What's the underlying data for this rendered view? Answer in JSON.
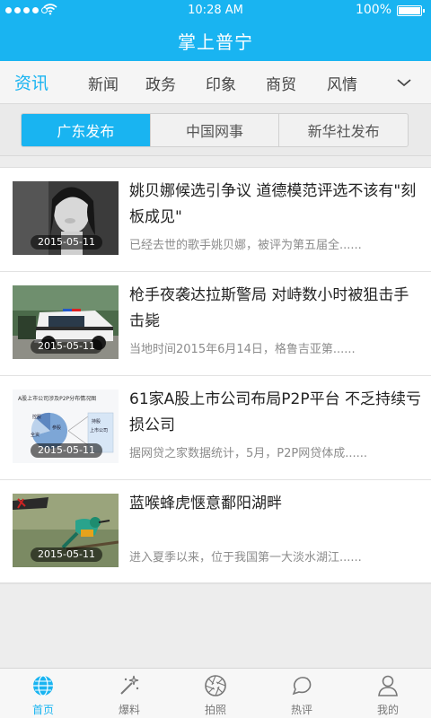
{
  "status": {
    "time": "10:28 AM",
    "battery": "100%"
  },
  "app_title": "掌上普宁",
  "categories": [
    "资讯",
    "新闻",
    "政务",
    "印象",
    "商贸",
    "风情"
  ],
  "segments": [
    "广东发布",
    "中国网事",
    "新华社发布"
  ],
  "news": [
    {
      "title": "姚贝娜候选引争议 道德模范评选不该有\"刻板成见\"",
      "summary": "已经去世的歌手姚贝娜，被评为第五届全......",
      "date": "2015-05-11"
    },
    {
      "title": "枪手夜袭达拉斯警局 对峙数小时被狙击手击毙",
      "summary": "当地时间2015年6月14日，格鲁吉亚第......",
      "date": "2015-05-11"
    },
    {
      "title": "61家A股上市公司布局P2P平台 不乏持续亏损公司",
      "summary": "据网贷之家数据统计，5月，P2P网贷体成......",
      "date": "2015-05-11",
      "thumb_text": "A股上市公司涉及P2P分布情况图",
      "thumb_labels": [
        "控股",
        "参股",
        "全资",
        "持股",
        "上市公司"
      ]
    },
    {
      "title": "蓝喉蜂虎惬意鄱阳湖畔",
      "summary": "进入夏季以来，位于我国第一大淡水湖江......",
      "date": "2015-05-11"
    }
  ],
  "tabs": [
    "首页",
    "爆料",
    "拍照",
    "热评",
    "我的"
  ],
  "colors": {
    "accent": "#19b4f1"
  }
}
